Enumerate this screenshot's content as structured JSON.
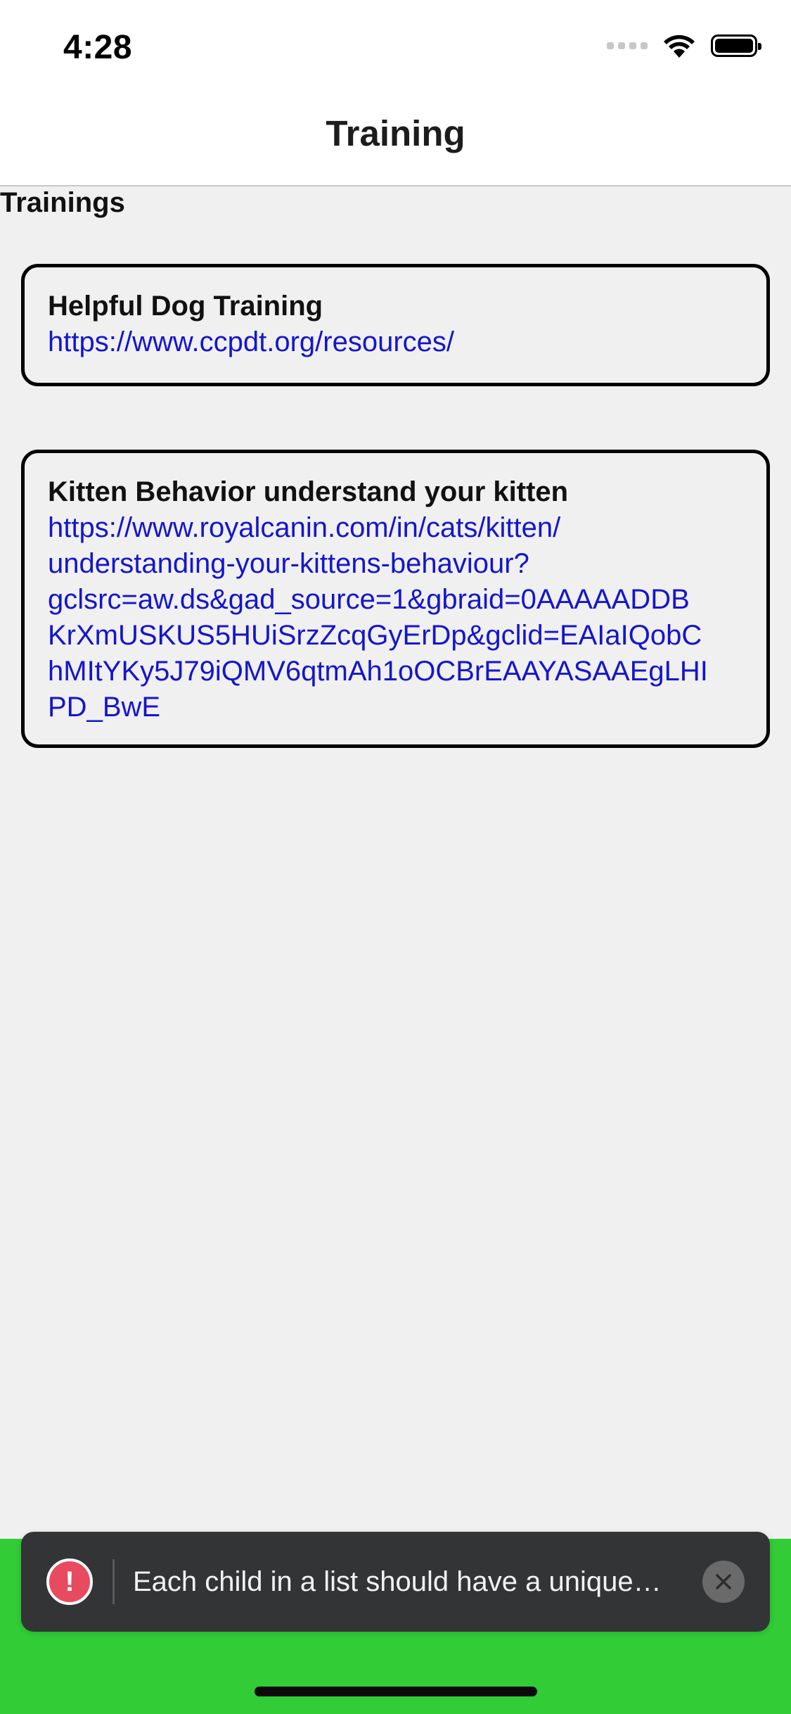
{
  "status_bar": {
    "time": "4:28",
    "icons": [
      "cellular-signal-icon",
      "wifi-icon",
      "battery-icon"
    ]
  },
  "nav": {
    "title": "Training"
  },
  "section": {
    "heading": "Trainings"
  },
  "trainings": [
    {
      "title": "Helpful Dog Training",
      "url": "https://www.ccpdt.org/resources/"
    },
    {
      "title": "Kitten Behavior understand your kitten",
      "url_lines": [
        "https://www.royalcanin.com/in/cats/kitten/",
        "understanding-your-kittens-behaviour?",
        "gclsrc=aw.ds&gad_source=1&gbraid=0AAAAADDB",
        "KrXmUSKUS5HUiSrzZcqGyErDp&gclid=EAIaIQobC",
        "hMItYKy5J79iQMV6qtmAh1oOCBrEAAYASAAEgLHI",
        "PD_BwE"
      ]
    }
  ],
  "toast": {
    "icon": "error-icon",
    "message": "Each child in a list should have a unique…",
    "close_icon": "close-icon"
  },
  "colors": {
    "link": "#1515cc",
    "bottom_bar": "#31cc36",
    "toast_background": "#333436",
    "error_icon": "#e84a5f"
  }
}
